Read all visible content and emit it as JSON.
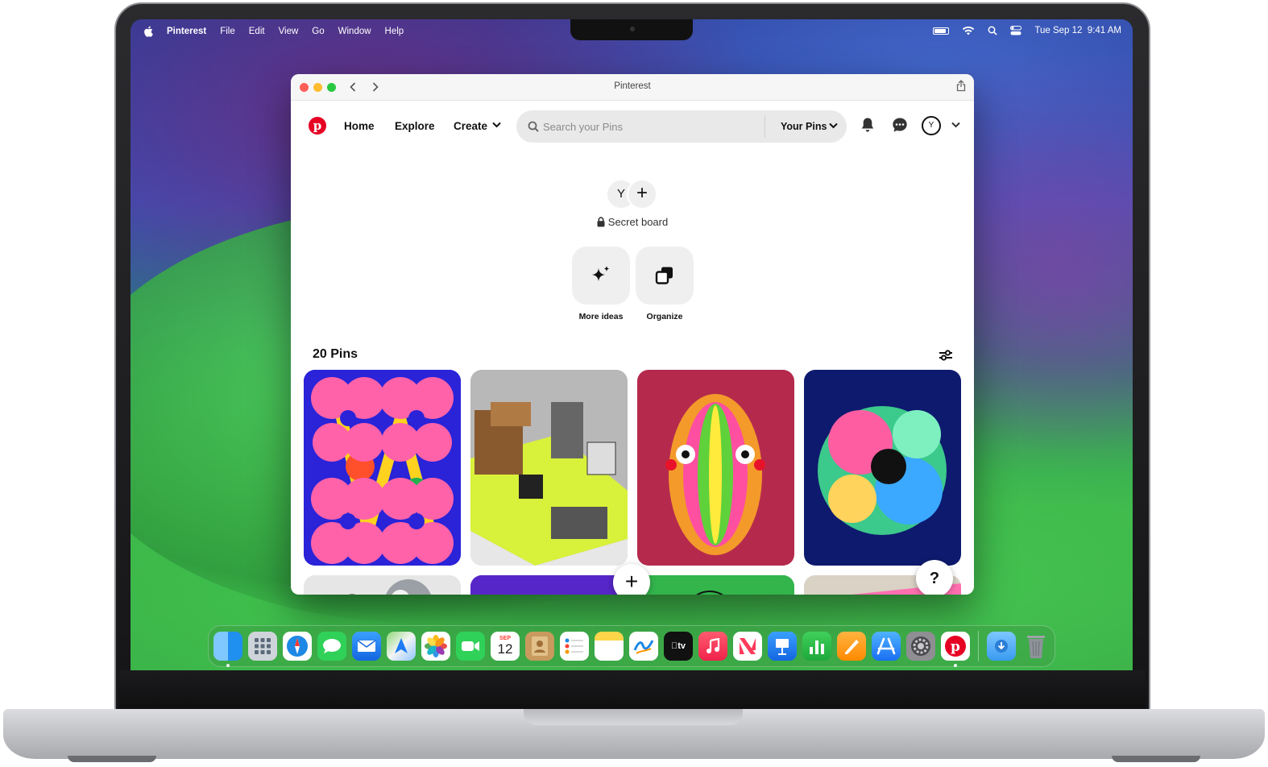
{
  "menubar": {
    "app_name": "Pinterest",
    "menus": [
      "File",
      "Edit",
      "View",
      "Go",
      "Window",
      "Help"
    ],
    "datetime": "Tue Sep 12  9:41 AM"
  },
  "window": {
    "title": "Pinterest"
  },
  "header": {
    "nav": {
      "home": "Home",
      "explore": "Explore",
      "create": "Create"
    },
    "search_placeholder": "Search your Pins",
    "scope": "Your Pins",
    "avatar_initial": "Y",
    "brand_color": "#e60023"
  },
  "board": {
    "avatar_initial": "Y",
    "visibility": "Secret board",
    "actions": {
      "more_ideas": "More ideas",
      "organize": "Organize"
    },
    "pins_count": "20 Pins"
  },
  "fab": {
    "add": "+",
    "help": "?"
  },
  "dock": {
    "apps": [
      "finder",
      "launchpad",
      "safari",
      "messages",
      "mail",
      "maps",
      "photos",
      "facetime",
      "calendar",
      "contacts",
      "reminders",
      "notes",
      "freeform",
      "tv",
      "music",
      "news",
      "keynote",
      "numbers",
      "pages",
      "app-store",
      "system-settings",
      "pinterest",
      "downloads",
      "trash"
    ],
    "calendar_month": "SEP",
    "calendar_day": "12",
    "tv_label": "tv"
  }
}
